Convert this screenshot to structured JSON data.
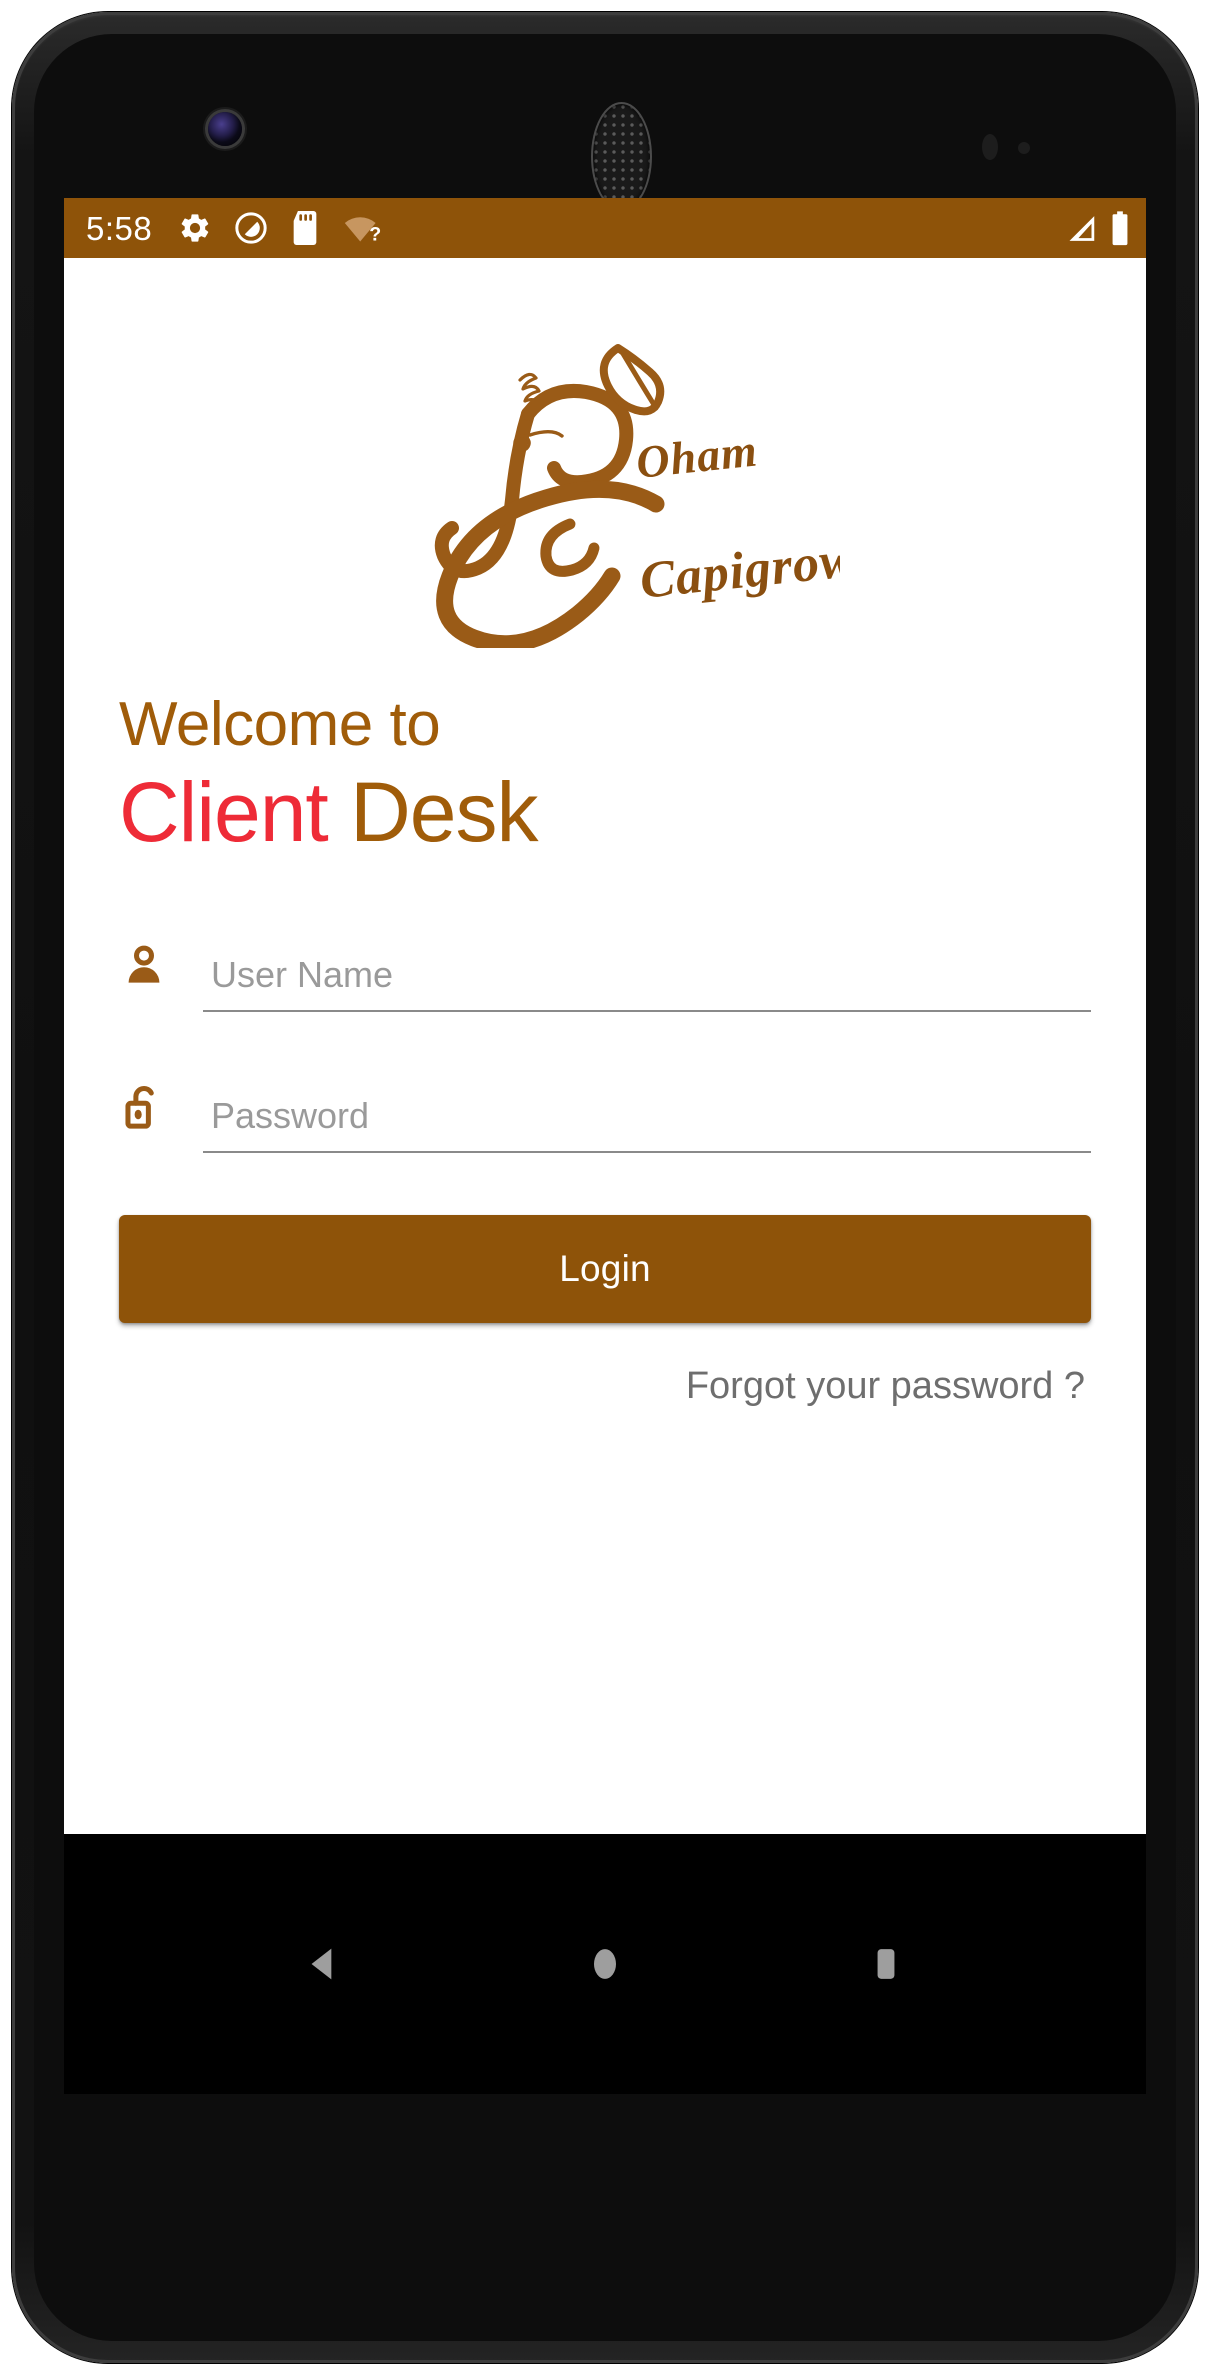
{
  "device": {
    "type": "android-phone",
    "frame_color": "#141414",
    "camera": "front-camera",
    "speaker": "earpiece-speaker"
  },
  "status_bar": {
    "background": "#8e5309",
    "time": "5:58",
    "left_icons": [
      {
        "name": "gear-icon",
        "label": "Settings"
      },
      {
        "name": "do-not-disturb-icon",
        "label": "Do Not Disturb"
      },
      {
        "name": "sd-card-icon",
        "label": "SD Card"
      },
      {
        "name": "wifi-question-icon",
        "label": "Wi-Fi no internet"
      }
    ],
    "right_icons": [
      {
        "name": "cell-signal-icon",
        "label": "Mobile signal"
      },
      {
        "name": "battery-icon",
        "label": "Battery full"
      }
    ]
  },
  "brand": {
    "logo_name": "soham-capigrow-logo",
    "script_word_top": "Oham",
    "script_word_bottom": "Capigrow",
    "logo_color": "#9a5b17",
    "logo_color_dark": "#8a4f10"
  },
  "headings": {
    "welcome": "Welcome to",
    "product_primary": "Client",
    "product_secondary": " Desk",
    "welcome_color": "#a05c09",
    "primary_color": "#ee2b37",
    "secondary_color": "#a05c09"
  },
  "form": {
    "username": {
      "icon": "person-icon",
      "placeholder": "User Name",
      "value": ""
    },
    "password": {
      "icon": "unlocked-padlock-icon",
      "placeholder": "Password",
      "value": ""
    },
    "submit_label": "Login",
    "submit_color": "#8e5309",
    "forgot_label": "Forgot your password ?"
  },
  "nav_bar": {
    "background": "#000000",
    "icon_color": "#9e9e9e",
    "buttons": [
      {
        "name": "nav-back-button",
        "label": "Back"
      },
      {
        "name": "nav-home-button",
        "label": "Home"
      },
      {
        "name": "nav-recents-button",
        "label": "Recents"
      }
    ]
  }
}
